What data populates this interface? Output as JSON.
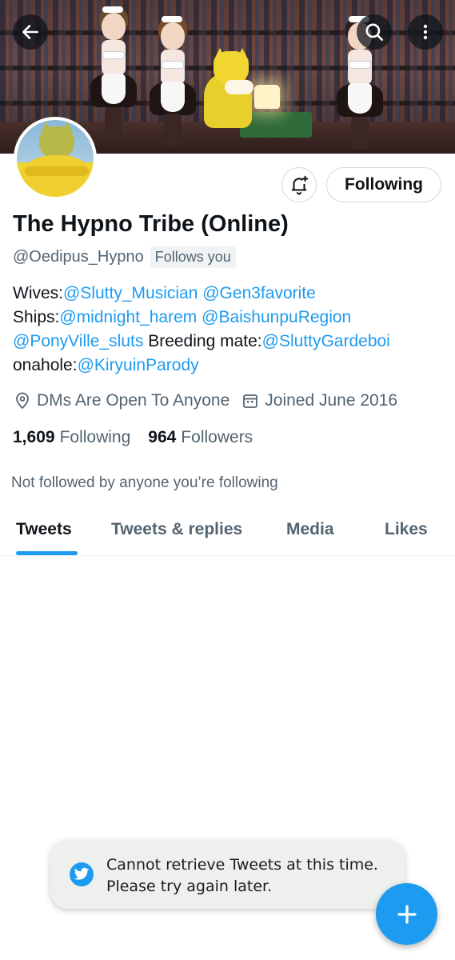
{
  "header": {
    "back_icon": "arrow-left-icon",
    "search_icon": "search-icon",
    "more_icon": "more-vertical-icon"
  },
  "profile": {
    "display_name": "The Hypno Tribe (Online)",
    "handle": "@Oedipus_Hypno",
    "follows_you_badge": "Follows you",
    "following_button": "Following",
    "notification_icon": "bell-plus-icon",
    "bio": {
      "line1_prefix": "Wives:",
      "line1_mention1": "@Slutty_Musician",
      "line1_mention2": "@Gen3favorite",
      "line2_prefix": "Ships:",
      "line2_mention1": "@midnight_harem",
      "line2_mention2": "@BaishunpuRegion",
      "line3_mention1": "@PonyVille_sluts",
      "line3_text": " Breeding mate:",
      "line3_mention2": "@SluttyGardeboi",
      "line4_prefix": "onahole:",
      "line4_mention": "@KiryuinParody"
    },
    "location": "DMs Are Open To Anyone",
    "joined": "Joined June 2016",
    "following_count": "1,609",
    "following_label": "Following",
    "followers_count": "964",
    "followers_label": "Followers",
    "not_followed_text": "Not followed by anyone you’re following"
  },
  "tabs": [
    {
      "label": "Tweets",
      "active": true
    },
    {
      "label": "Tweets & replies",
      "active": false
    },
    {
      "label": "Media",
      "active": false
    },
    {
      "label": "Likes",
      "active": false
    }
  ],
  "toast": {
    "line1": "Cannot retrieve Tweets at this time.",
    "line2": "Please try again later.",
    "icon": "twitter-bird-icon"
  },
  "fab": {
    "icon": "plus-icon"
  },
  "colors": {
    "accent": "#1d9bf0",
    "text_primary": "#0f1419",
    "text_secondary": "#536471"
  }
}
